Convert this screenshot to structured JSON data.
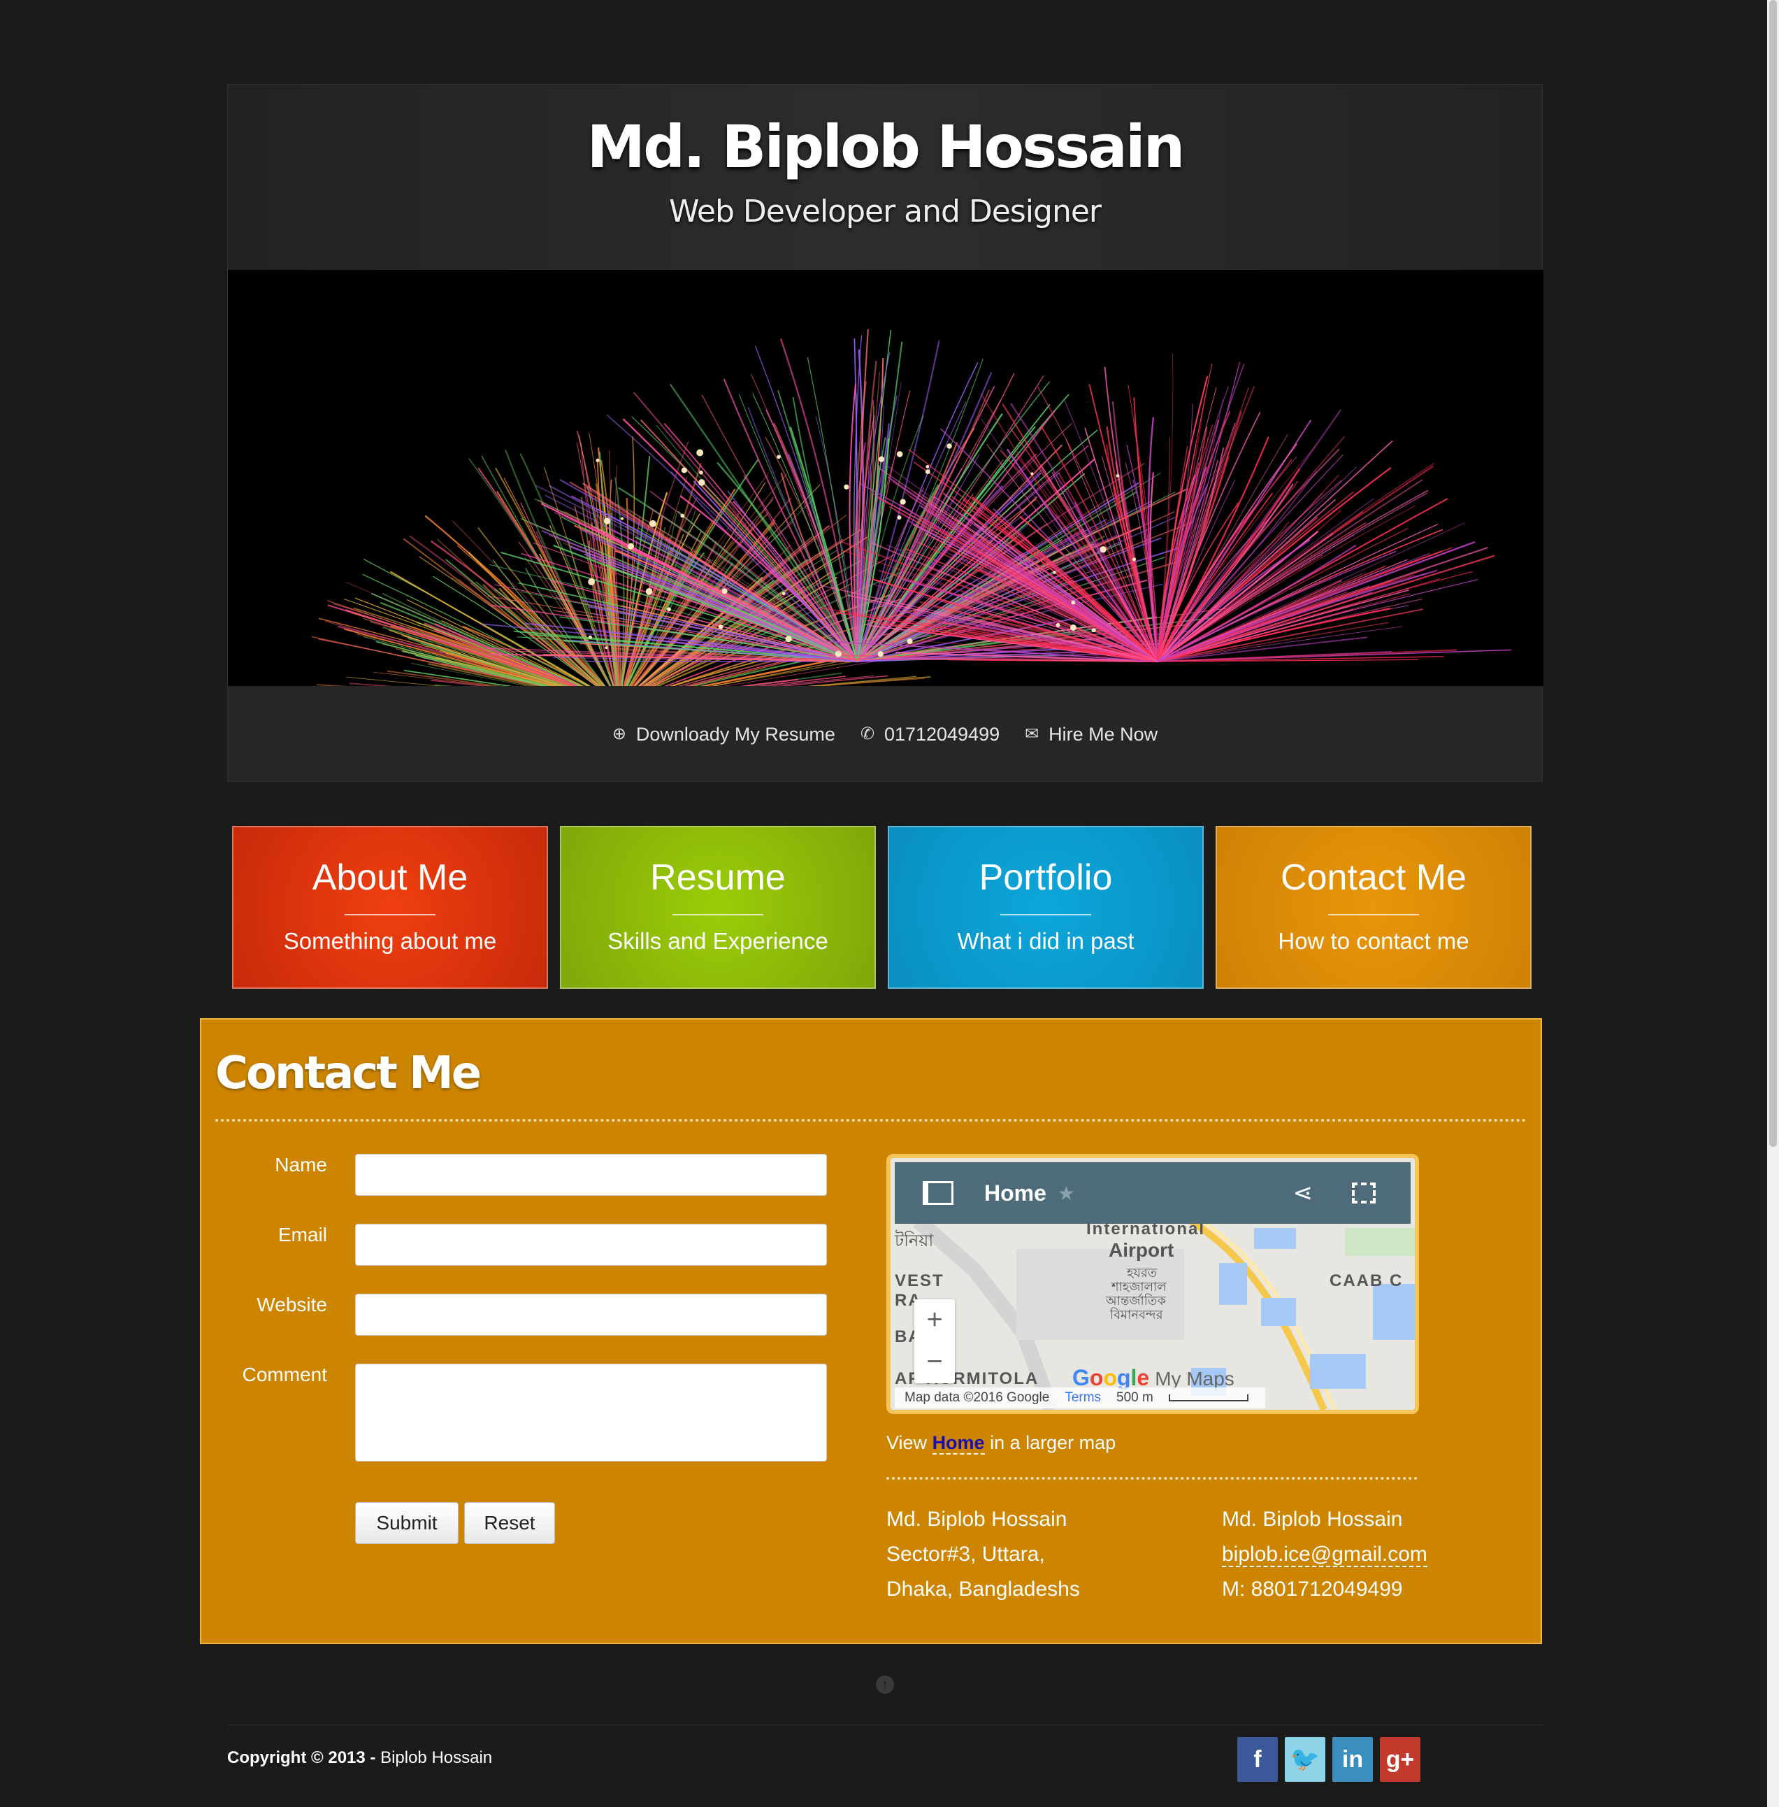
{
  "header": {
    "name": "Md. Biplob Hossain",
    "tagline": "Web Developer and Designer",
    "links": [
      {
        "icon": "download-circle-icon",
        "label": "Downloady My Resume"
      },
      {
        "icon": "phone-icon",
        "label": "01712049499"
      },
      {
        "icon": "envelope-icon",
        "label": "Hire Me Now"
      }
    ]
  },
  "tiles": [
    {
      "title": "About Me",
      "subtitle": "Something about me",
      "color": "#e23510"
    },
    {
      "title": "Resume",
      "subtitle": "Skills and Experience",
      "color": "#8cbf07"
    },
    {
      "title": "Portfolio",
      "subtitle": "What i did in past",
      "color": "#0b9dd0"
    },
    {
      "title": "Contact Me",
      "subtitle": "How to contact me",
      "color": "#dd8b05"
    }
  ],
  "contact": {
    "heading": "Contact Me",
    "form": {
      "name_label": "Name",
      "email_label": "Email",
      "website_label": "Website",
      "comment_label": "Comment",
      "submit_label": "Submit",
      "reset_label": "Reset"
    },
    "map": {
      "title": "Home",
      "labels": [
        "International",
        "Airport",
        "হযরত",
        "শাহজালাল",
        "আন্তর্জাতিক",
        "বিমানবন্দর",
        "CAAB C",
        "VEST",
        "RA",
        "BA",
        "AF KURMITOLA",
        "টনিয়া"
      ],
      "logo": "Google",
      "logo_suffix": "My Maps",
      "attribution": "Map data ©2016 Google",
      "terms": "Terms",
      "scale": "500 m"
    },
    "view_map": {
      "prefix": "View",
      "link": "Home",
      "suffix": "in a larger map"
    },
    "address": [
      "Md. Biplob Hossain",
      "Sector#3, Uttara,",
      "Dhaka, Bangladeshs"
    ],
    "details": {
      "name": "Md. Biplob Hossain",
      "email": "biplob.ice@gmail.com",
      "phone": "M: 8801712049499"
    }
  },
  "footer": {
    "copyright_prefix": "Copyright © 2013 -",
    "copyright_name": "Biplob Hossain",
    "social": [
      {
        "icon": "facebook-icon",
        "glyph": "f",
        "color": "#3b5998"
      },
      {
        "icon": "twitter-icon",
        "glyph": "🐦",
        "color": "#8fd3e8"
      },
      {
        "icon": "linkedin-icon",
        "glyph": "in",
        "color": "#3b8fbf"
      },
      {
        "icon": "google-plus-icon",
        "glyph": "g+",
        "color": "#c0392b"
      }
    ]
  }
}
